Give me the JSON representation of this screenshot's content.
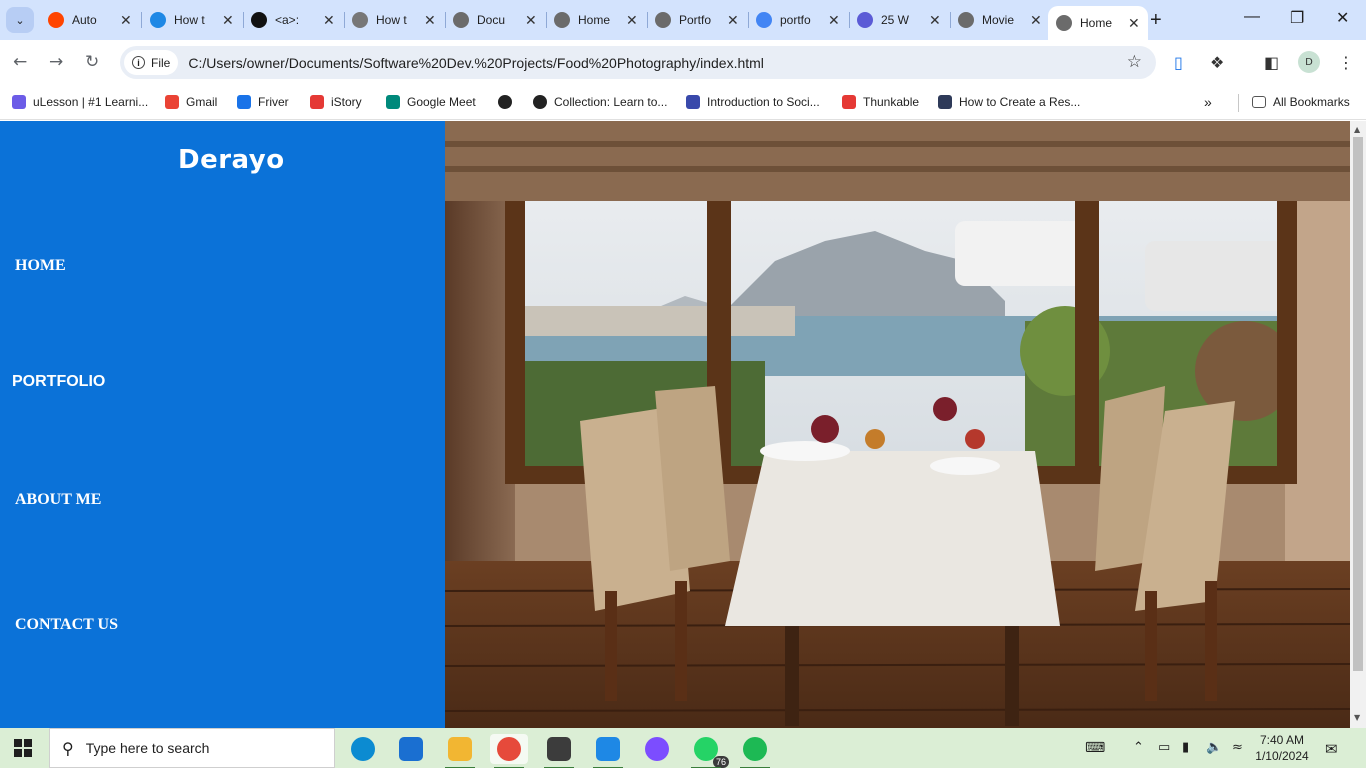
{
  "browser": {
    "tabs": [
      {
        "title": "Auto",
        "favicon": "reddit-icon",
        "color": "#ff4500"
      },
      {
        "title": "How t",
        "favicon": "page-icon",
        "color": "#1e88e5"
      },
      {
        "title": "<a>:",
        "favicon": "m-logo-icon",
        "color": "#111111"
      },
      {
        "title": "How t",
        "favicon": "book-icon",
        "color": "#777777"
      },
      {
        "title": "Docu",
        "favicon": "globe-icon",
        "color": "#6b6b6b"
      },
      {
        "title": "Home",
        "favicon": "globe-icon",
        "color": "#6b6b6b"
      },
      {
        "title": "Portfo",
        "favicon": "globe-icon",
        "color": "#6b6b6b"
      },
      {
        "title": "portfo",
        "favicon": "google-icon",
        "color": "#4285f4"
      },
      {
        "title": "25 W",
        "favicon": "hashnode-icon",
        "color": "#5b5bd6"
      },
      {
        "title": "Movie",
        "favicon": "globe-icon",
        "color": "#6b6b6b"
      },
      {
        "title": "Home",
        "favicon": "globe-icon",
        "color": "#6b6b6b"
      }
    ],
    "address": {
      "chip_label": "File",
      "url": "C:/Users/owner/Documents/Software%20Dev.%20Projects/Food%20Photography/index.html"
    },
    "bookmarks": [
      {
        "label": "uLesson | #1 Learni...",
        "icon": "ulesson-icon",
        "color": "#6c5ce7"
      },
      {
        "label": "Gmail",
        "icon": "gmail-icon",
        "color": "#ea4335"
      },
      {
        "label": "Friver",
        "icon": "friver-icon",
        "color": "#1a73e8"
      },
      {
        "label": "iStory",
        "icon": "istory-icon",
        "color": "#e53935"
      },
      {
        "label": "Google Meet",
        "icon": "meet-icon",
        "color": "#00897b"
      },
      {
        "label": "",
        "icon": "globe-icon",
        "color": "#222222"
      },
      {
        "label": "Collection: Learn to...",
        "icon": "github-icon",
        "color": "#222222"
      },
      {
        "label": "Introduction to Soci...",
        "icon": "crest-icon",
        "color": "#3949ab"
      },
      {
        "label": "Thunkable",
        "icon": "thunkable-icon",
        "color": "#e53935"
      },
      {
        "label": "How to Create a Res...",
        "icon": "w3-icon",
        "color": "#2e3a59"
      }
    ],
    "all_bookmarks": "All Bookmarks",
    "profile_initial": "D"
  },
  "site": {
    "brand": "Derayo",
    "nav": [
      {
        "label": "HOME"
      },
      {
        "label": "PORTFOLIO"
      },
      {
        "label": "ABOUT ME"
      },
      {
        "label": "CONTACT US"
      }
    ],
    "sidebar_color": "#0b72d8"
  },
  "taskbar": {
    "search_placeholder": "Type here to search",
    "apps": [
      {
        "name": "edge-icon",
        "color": "#0c8bd1"
      },
      {
        "name": "store-icon",
        "color": "#1a6fd1"
      },
      {
        "name": "file-explorer-icon",
        "color": "#f2b632"
      },
      {
        "name": "chrome-icon",
        "color": "#e64a3b"
      },
      {
        "name": "wattpad-icon",
        "color": "#3c3c3c"
      },
      {
        "name": "vscode-icon",
        "color": "#1e88e5"
      },
      {
        "name": "canva-icon",
        "color": "#7c4dff"
      },
      {
        "name": "whatsapp-icon",
        "color": "#25d366"
      },
      {
        "name": "spotify-icon",
        "color": "#1db954"
      }
    ],
    "whatsapp_badge": "76",
    "time": "7:40 AM",
    "date": "1/10/2024"
  }
}
